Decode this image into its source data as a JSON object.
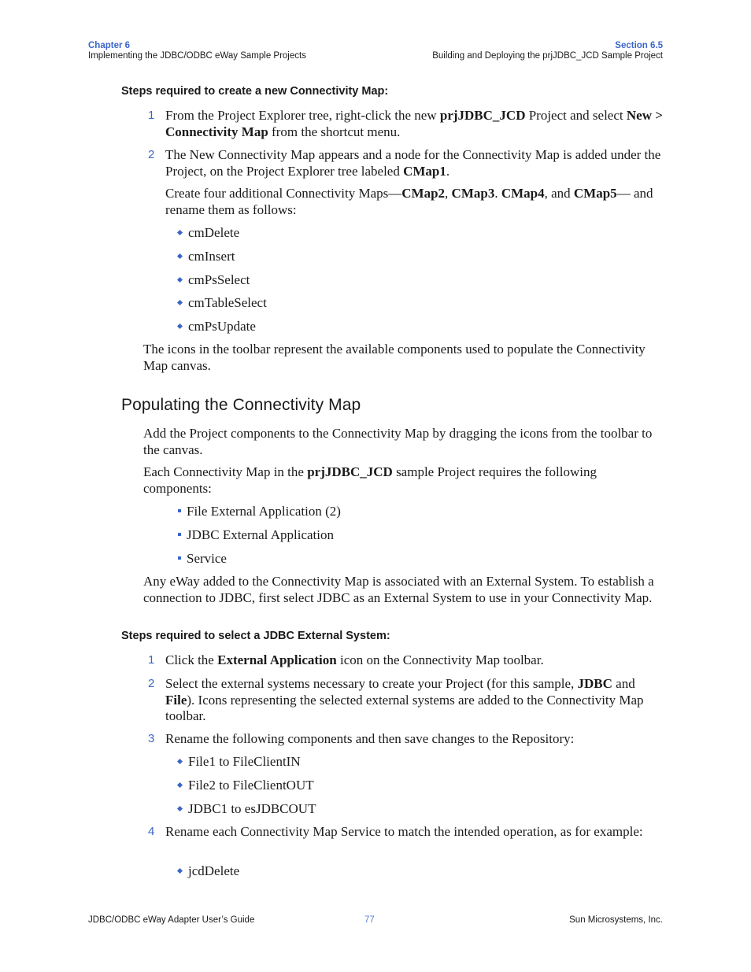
{
  "header": {
    "chapter_label": "Chapter 6",
    "chapter_title": "Implementing the JDBC/ODBC eWay Sample Projects",
    "section_label": "Section 6.5",
    "section_title": "Building and Deploying the prjJDBC_JCD Sample Project"
  },
  "section1": {
    "subhead": "Steps required to create a new Connectivity Map:",
    "step1": {
      "num": "1",
      "t1": "From the Project Explorer tree, right-click the new ",
      "b1": "prjJDBC_JCD",
      "t2": " Project and select ",
      "b2": "New > Connectivity Map",
      "t3": " from the shortcut menu."
    },
    "step2": {
      "num": "2",
      "t1": "The New Connectivity Map appears and a node for the Connectivity Map is added under the Project, on the Project Explorer tree labeled ",
      "b1": "CMap1",
      "t2": "."
    },
    "step2_followup": {
      "t1": "Create four additional Connectivity Maps—",
      "b1": "CMap2",
      "t2": ", ",
      "b2": "CMap3",
      "t3": ". ",
      "b3": "CMap4",
      "t4": ", and ",
      "b4": "CMap5",
      "t5": "— and rename them as follows:"
    },
    "rename_list": [
      "cmDelete",
      "cmInsert",
      "cmPsSelect",
      "cmTableSelect",
      "cmPsUpdate"
    ],
    "toolbar_note": "The icons in the toolbar represent the available components used to populate the Connectivity Map canvas."
  },
  "section2": {
    "heading": "Populating the Connectivity Map",
    "para1": "Add the Project components to the Connectivity Map by dragging the icons from the toolbar to the canvas.",
    "para2": {
      "t1": "Each Connectivity Map in the ",
      "b1": "prjJDBC_JCD",
      "t2": " sample Project requires the following components:"
    },
    "components": [
      "File External Application (2)",
      "JDBC External Application",
      "Service"
    ],
    "para3": "Any eWay added to the Connectivity Map is associated with an External System. To establish a connection to JDBC, first select JDBC as an External System to use in your Connectivity Map.",
    "subhead": "Steps required to select a JDBC External System:",
    "step1": {
      "num": "1",
      "t1": "Click the ",
      "b1": "External Application",
      "t2": " icon on the Connectivity Map toolbar."
    },
    "step2": {
      "num": "2",
      "t1": "Select the external systems necessary to create your Project (for this sample, ",
      "b1": "JDBC",
      "t2": " and ",
      "b2": "File",
      "t3": "). Icons representing the selected external systems are added to the Connectivity Map toolbar."
    },
    "step3": {
      "num": "3",
      "t1": "Rename the following components and then save changes to the Repository:"
    },
    "rename_components": [
      "File1 to FileClientIN",
      "File2 to FileClientOUT",
      "JDBC1 to esJDBCOUT"
    ],
    "step4": {
      "num": "4",
      "t1": "Rename each Connectivity Map Service to match the intended operation, as for example:"
    },
    "service_examples": [
      "jcdDelete"
    ]
  },
  "footer": {
    "guide_title": "JDBC/ODBC eWay Adapter User’s Guide",
    "page_number": "77",
    "company": "Sun Microsystems, Inc."
  }
}
